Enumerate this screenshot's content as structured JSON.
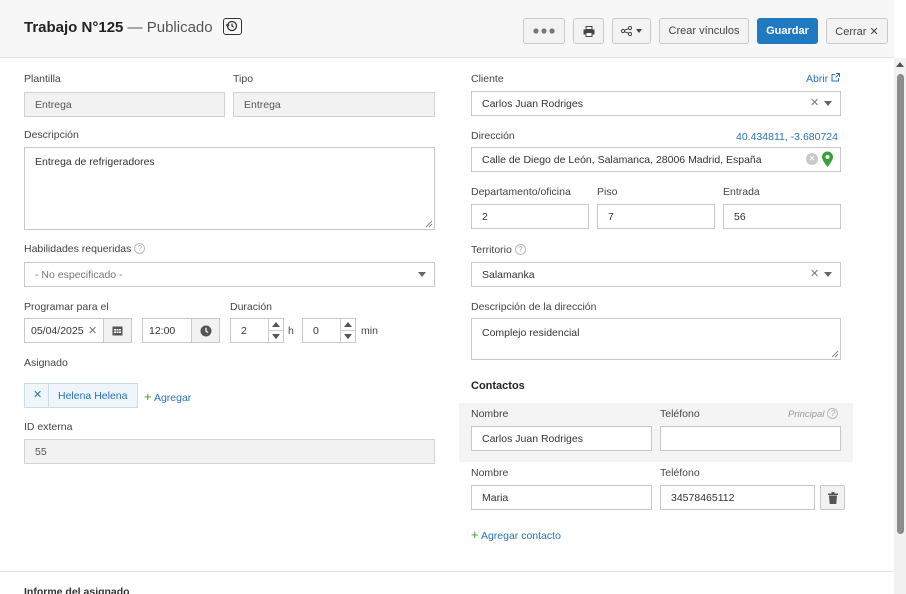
{
  "header": {
    "title_main": "Trabajo N°125",
    "title_sep": "—",
    "status": "Publicado",
    "buttons": {
      "print": "print-icon",
      "share": "share-icon",
      "create_links": "Crear vínculos",
      "save": "Guardar",
      "close": "Cerrar ✕"
    },
    "accent_color": "#1f7ac2"
  },
  "left": {
    "template_label": "Plantilla",
    "template_value": "Entrega",
    "type_label": "Tipo",
    "type_value": "Entrega",
    "description_label": "Descripción",
    "description_value": "Entrega de refrigeradores",
    "skills_label": "Habilidades requeridas",
    "skills_value": "- No especificado -",
    "schedule_label": "Programar para el",
    "schedule_date": "05/04/2025",
    "schedule_time": "12:00",
    "duration_label": "Duración",
    "duration_hours": "2",
    "hours_unit": "h",
    "duration_minutes": "0",
    "minutes_unit": "min",
    "assigned_label": "Asignado",
    "assignee": "Helena Helena",
    "add_label": "Agregar",
    "external_id_label": "ID externa",
    "external_id_value": "55",
    "assignee_report_label": "Informe del asignado"
  },
  "right": {
    "client_label": "Cliente",
    "open_link": "Abrir",
    "client_value": "Carlos Juan Rodriges",
    "address_label": "Dirección",
    "coords": "40.434811, -3.680724",
    "address_value": "Calle de Diego de León, Salamanca, 28006 Madrid, España",
    "dept_label": "Departamento/oficina",
    "dept_value": "2",
    "floor_label": "Piso",
    "floor_value": "7",
    "entrance_label": "Entrada",
    "entrance_value": "56",
    "territory_label": "Territorio",
    "territory_value": "Salamanka",
    "address_desc_label": "Descripción de la dirección",
    "address_desc_value": "Complejo residencial",
    "contacts_title": "Contactos",
    "principal_label": "Principal",
    "contacts": [
      {
        "name_label": "Nombre",
        "name": "Carlos Juan Rodriges",
        "phone_label": "Teléfono",
        "phone": ""
      },
      {
        "name_label": "Nombre",
        "name": "Maria",
        "phone_label": "Teléfono",
        "phone": "34578465112"
      }
    ],
    "add_contact": "Agregar contacto"
  }
}
